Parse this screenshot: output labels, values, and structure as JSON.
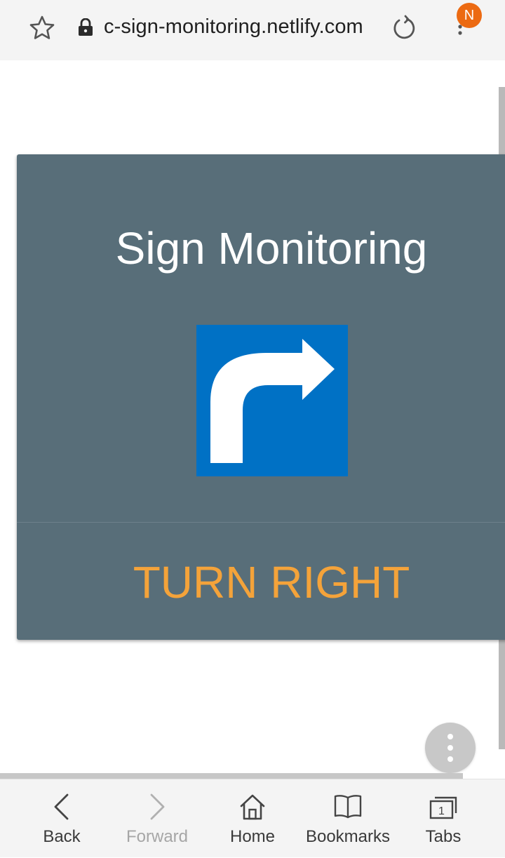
{
  "browser": {
    "url": "c-sign-monitoring.netlify.com",
    "avatar_letter": "N",
    "avatar_color": "#ec6a12",
    "icons": [
      "star-icon",
      "lock-icon",
      "reload-icon",
      "menu-dots-icon"
    ]
  },
  "card": {
    "title": "Sign Monitoring",
    "sign_name": "turn-right-arrow-sign",
    "caption": "TURN RIGHT",
    "background_color": "#586e79",
    "caption_color": "#f4a33a",
    "sign_color": "#0071c5"
  },
  "bottom_nav": {
    "items": [
      {
        "label": "Back",
        "icon": "back-arrow-icon",
        "enabled": true
      },
      {
        "label": "Forward",
        "icon": "forward-arrow-icon",
        "enabled": false
      },
      {
        "label": "Home",
        "icon": "home-icon",
        "enabled": true
      },
      {
        "label": "Bookmarks",
        "icon": "bookmarks-icon",
        "enabled": true
      },
      {
        "label": "Tabs",
        "icon": "tabs-icon",
        "enabled": true,
        "count": "1"
      }
    ]
  }
}
